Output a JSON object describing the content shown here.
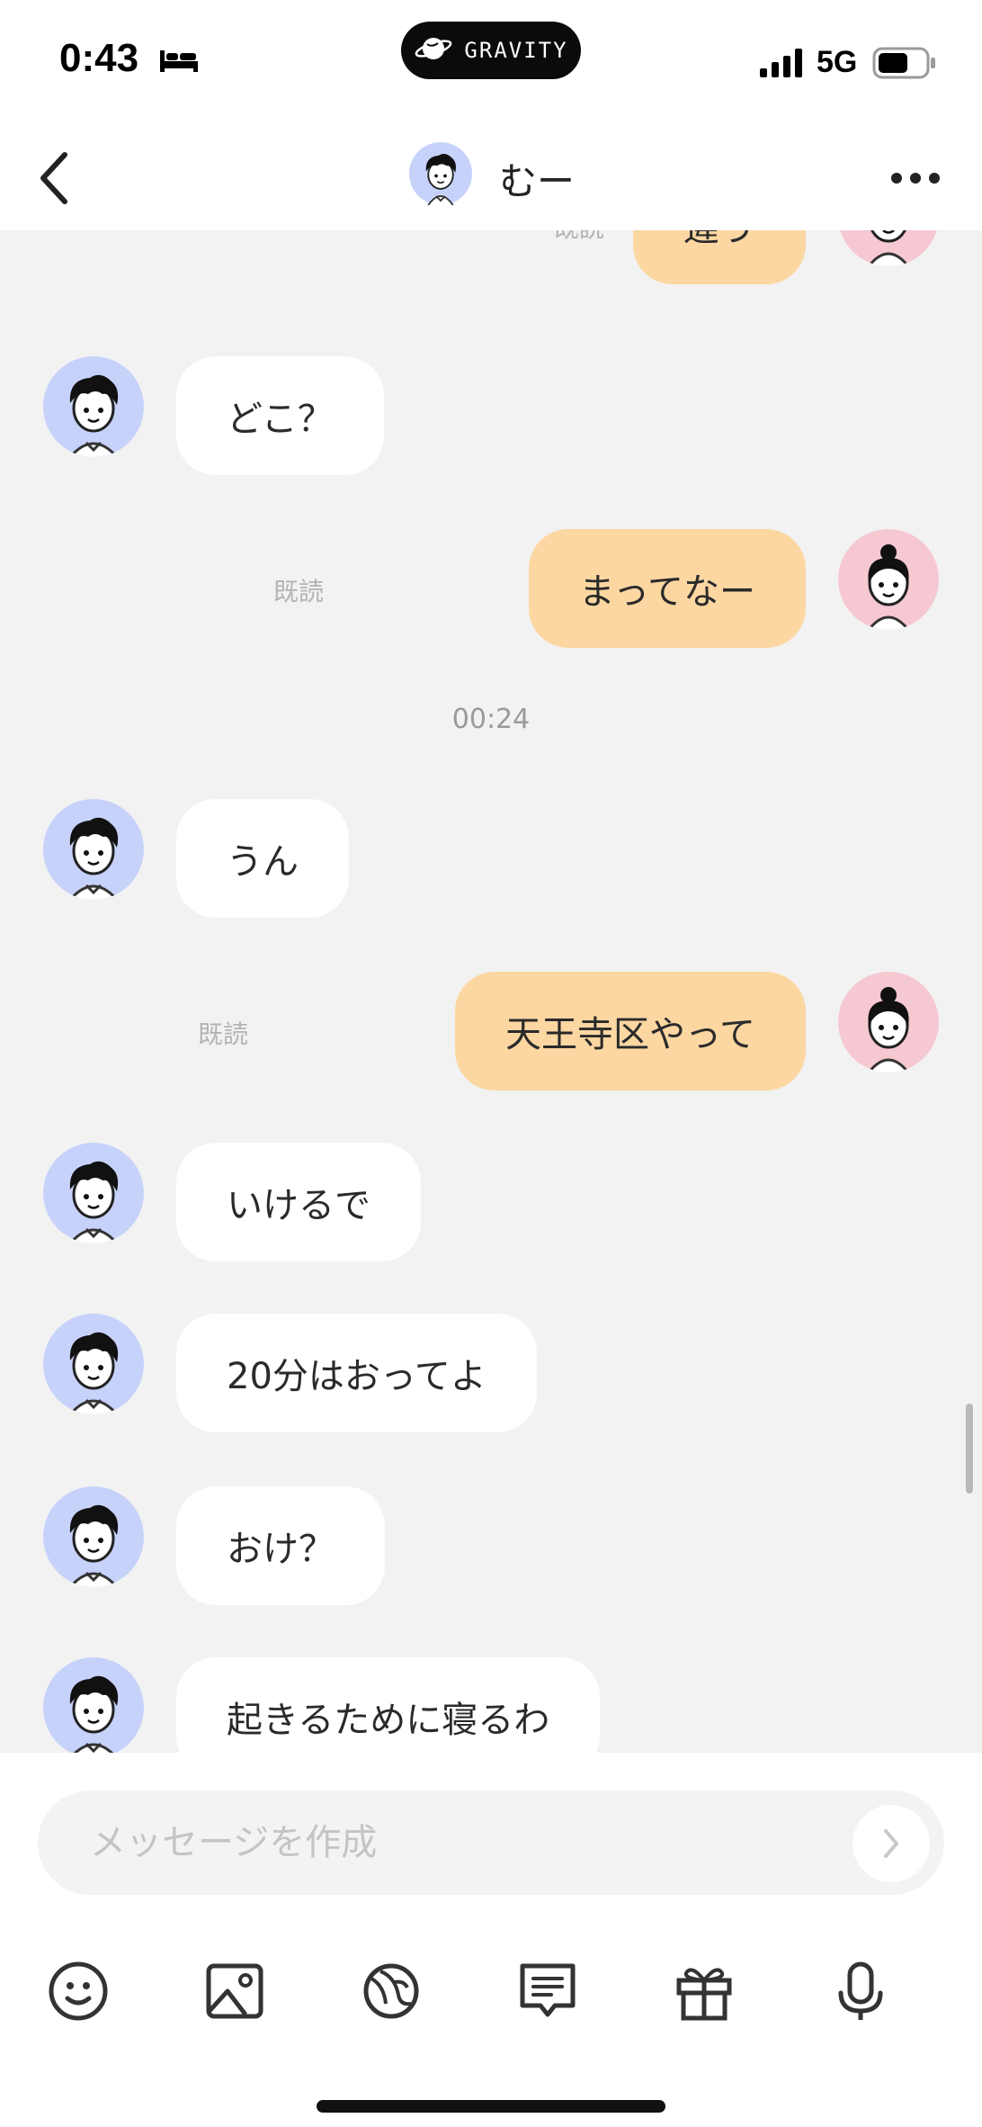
{
  "status_bar": {
    "time": "0:43",
    "pill_label": "GRAVITY",
    "network": "5G"
  },
  "header": {
    "title": "むー"
  },
  "messages": [
    {
      "dir": "out",
      "text": "違う",
      "read": "既読"
    },
    {
      "dir": "in",
      "text": "どこ？"
    },
    {
      "dir": "out",
      "text": "まってなー",
      "read": "既読"
    },
    {
      "timestamp": "00:24"
    },
    {
      "dir": "in",
      "text": "うん"
    },
    {
      "dir": "out",
      "text": "天王寺区やって",
      "read": "既読"
    },
    {
      "dir": "in",
      "text": "いけるで"
    },
    {
      "dir": "in",
      "text": "20分はおってよ"
    },
    {
      "dir": "in",
      "text": "おけ？"
    },
    {
      "dir": "in",
      "text": "起きるために寝るわ"
    }
  ],
  "composer": {
    "placeholder": "メッセージを作成"
  },
  "toolbar_icons": [
    "smile-icon",
    "image-icon",
    "planet-icon",
    "message-list-icon",
    "gift-icon",
    "microphone-icon"
  ],
  "colors": {
    "incoming_bubble": "#ffffff",
    "outgoing_bubble": "#fcd7a2",
    "chat_background": "#f2f2f2",
    "male_avatar_bg": "#c7d2fb",
    "female_avatar_bg": "#f6c8d2"
  }
}
